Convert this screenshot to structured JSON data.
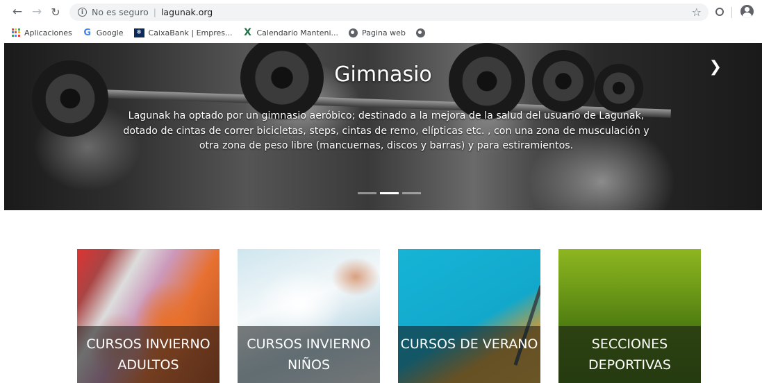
{
  "browser": {
    "insecure_label": "No es seguro",
    "separator": "|",
    "url": "lagunak.org"
  },
  "bookmarks": [
    {
      "label": "Aplicaciones",
      "icon": "apps-icon"
    },
    {
      "label": "Google",
      "icon": "google-icon"
    },
    {
      "label": "CaixaBank | Empres...",
      "icon": "caixabank-icon"
    },
    {
      "label": "Calendario Manteni...",
      "icon": "excel-icon"
    },
    {
      "label": "Pagina web",
      "icon": "globe-icon"
    }
  ],
  "hero": {
    "title": "Gimnasio",
    "text": "Lagunak ha optado por un gimnasio aeróbico; destinado a la mejora de la salud del usuario de Lagunak, dotado de cintas de correr bicicletas, steps, cintas de remo, elípticas etc. , con una zona de musculación y otra zona de peso libre (mancuernas, discos y barras) y para estiramientos."
  },
  "cards": [
    {
      "label": "CURSOS INVIERNO ADULTOS"
    },
    {
      "label": "CURSOS INVIERNO NIÑOS"
    },
    {
      "label": "CURSOS DE VERANO"
    },
    {
      "label": "SECCIONES DEPORTIVAS"
    }
  ],
  "colors": {
    "overlay": "#141414",
    "text_on_image": "#ffffff",
    "google_blue": "#4285f4",
    "excel_green": "#1e7145"
  }
}
